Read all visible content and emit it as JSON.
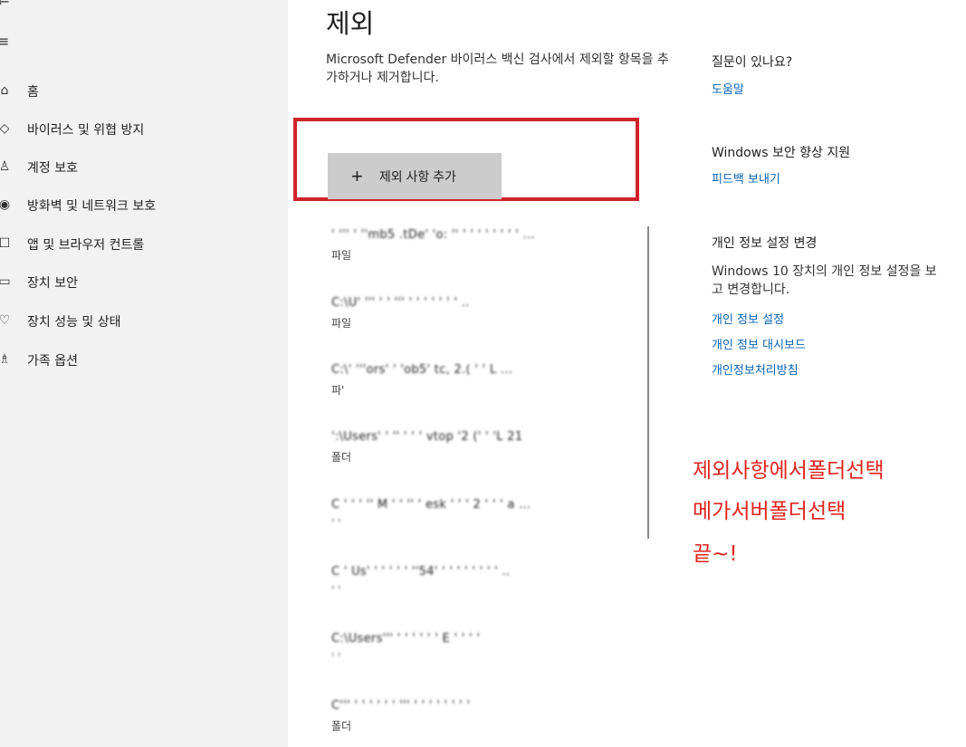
{
  "sidebar": {
    "items": [
      {
        "icon": "home-icon",
        "glyph": "⌂",
        "label": "홈"
      },
      {
        "icon": "shield-icon",
        "glyph": "◇",
        "label": "바이러스 및 위협 방지"
      },
      {
        "icon": "person-icon",
        "glyph": "♙",
        "label": "계정 보호"
      },
      {
        "icon": "wifi-icon",
        "glyph": "◉",
        "label": "방화벽 및 네트워크 보호"
      },
      {
        "icon": "app-browser-icon",
        "glyph": "☐",
        "label": "앱 및 브라우저 컨트롤"
      },
      {
        "icon": "device-icon",
        "glyph": "▭",
        "label": "장치 보안"
      },
      {
        "icon": "heart-icon",
        "glyph": "♡",
        "label": "장치 성능 및 상태"
      },
      {
        "icon": "family-icon",
        "glyph": "♗",
        "label": "가족 옵션"
      }
    ]
  },
  "main": {
    "title": "제외",
    "description": "Microsoft Defender 바이러스 백신 검사에서 제외할 항목을 추가하거나 제거합니다.",
    "add_button": {
      "icon": "plus-icon",
      "label": "제외 사항 추가"
    },
    "exclusions": [
      {
        "path": "'   '''   '   ''mb5  .tDe'  'o:  ''  ' ' ' ' ' ' ' ' ...",
        "type": "파일"
      },
      {
        "path": "C:\\U'   '''      '   '   '''   '  ' '  '  ' ' ' ..",
        "type": "파일"
      },
      {
        "path": "C:\\'  '''ors'  ' 'ob5'      tc,  2.(  '  '  L ...",
        "type": "파'"
      },
      {
        "path": "':\\Users'  ' ''  ' ' ' vtop  '2 ('  '  'L  21",
        "type": "폴더"
      },
      {
        "path": "C  ' '  ' ''  M  ' ' ''  '  esk  ' ' ' 2 ' ' ' a ...",
        "type": "' '"
      },
      {
        "path": "C ' Us' ' '  ' '  ' ''54' '   '  '  '  '  '  ' ' ..",
        "type": "' '"
      },
      {
        "path": "C:\\Users'''  '  '   '  '  '   '  E  ' ' ' '",
        "type": "' '"
      },
      {
        "path": "C'''  ' '  ' ' '  '  '''  '  '  '  '  '  '  ' '",
        "type": "폴더"
      }
    ]
  },
  "right": {
    "question_heading": "질문이 있나요?",
    "help_link": "도움말",
    "improve_heading": "Windows 보안 향상 지원",
    "feedback_link": "피드백 보내기",
    "privacy_heading": "개인 정보 설정 변경",
    "privacy_desc": "Windows 10 장치의 개인 정보 설정을 보고 변경합니다.",
    "privacy_links": [
      "개인 정보 설정",
      "개인 정보 대시보드",
      "개인정보처리방침"
    ]
  },
  "annotation": {
    "lines": [
      "제외사항에서폴더선택",
      "메가서버폴더선택",
      "끝~!"
    ]
  },
  "colors": {
    "highlight_border": "#d0232a",
    "annotation_text": "#e0241f",
    "link": "#0a64b5",
    "sidebar_bg": "#f2f2f2",
    "button_bg": "#cccccc"
  }
}
